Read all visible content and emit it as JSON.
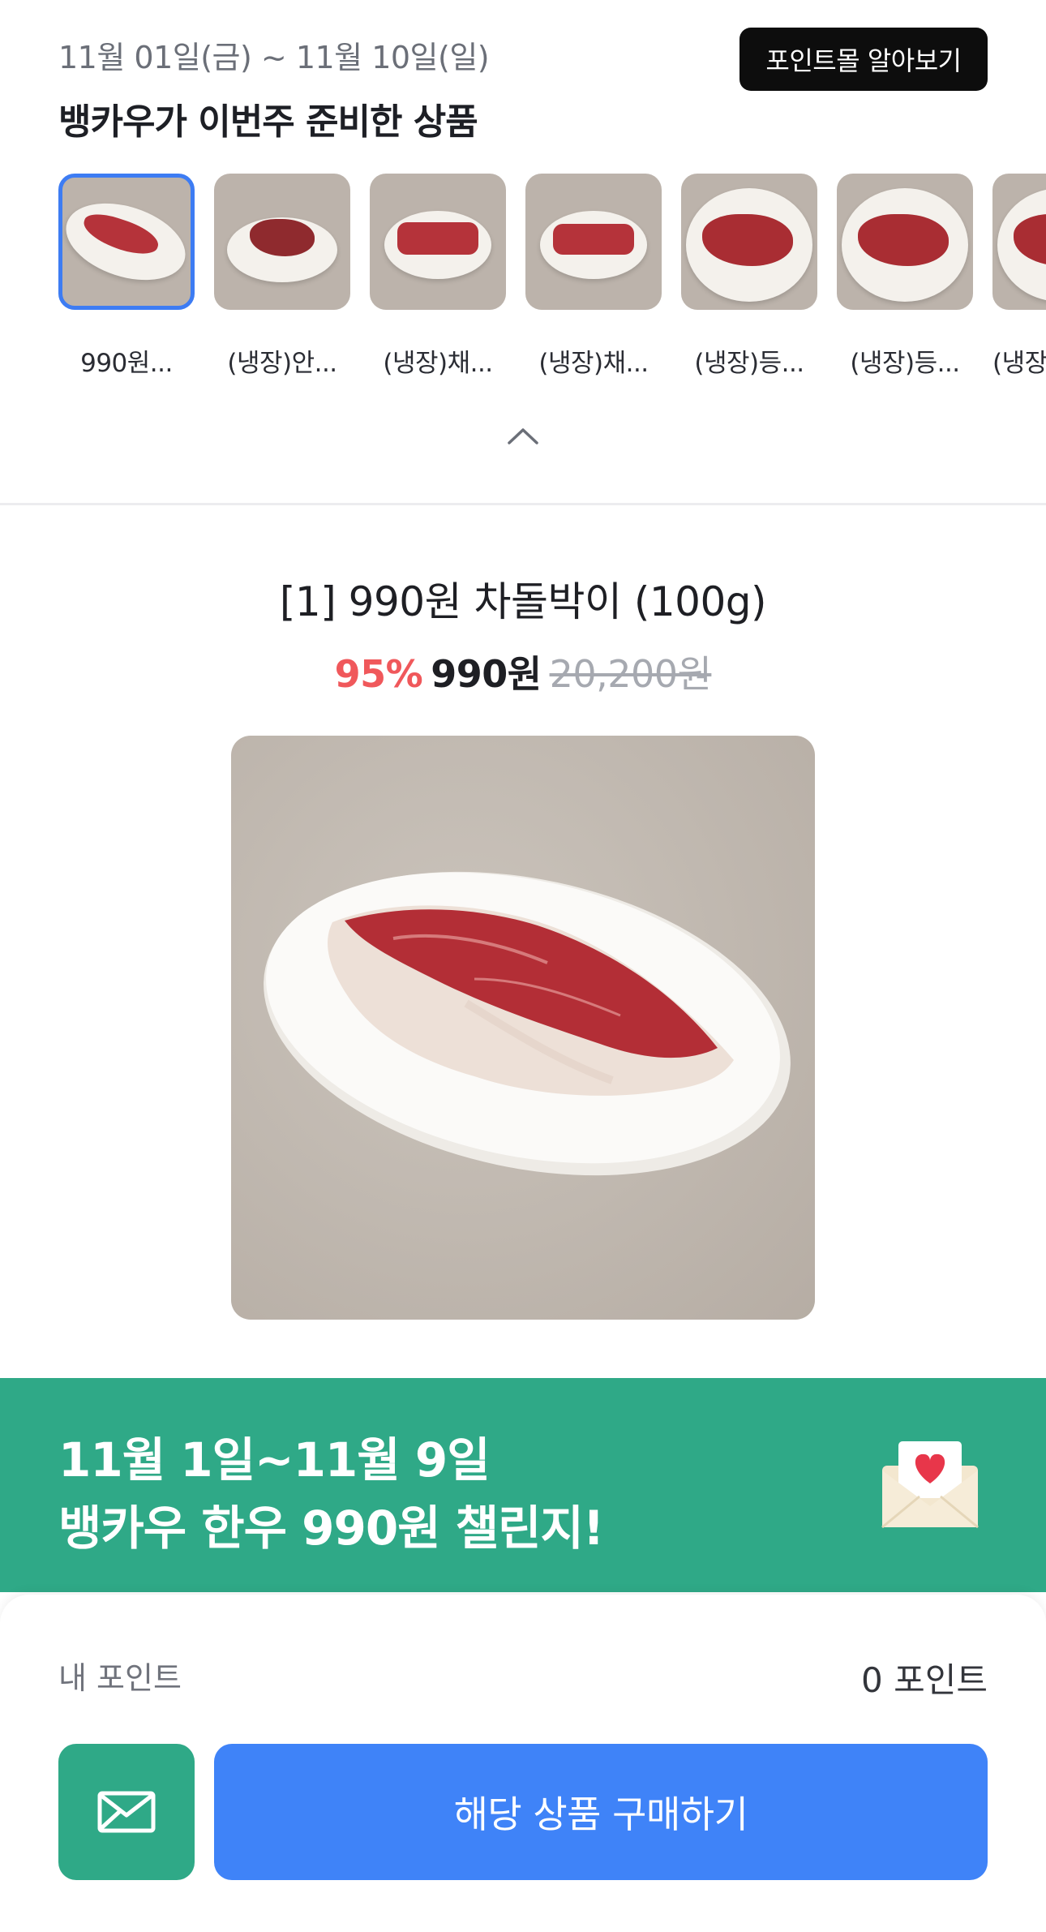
{
  "header": {
    "date_range": "11월 01일(금) ~ 11월 10일(일)",
    "headline": "뱅카우가 이번주 준비한 상품",
    "pointmall_button": "포인트몰 알아보기"
  },
  "thumbnails": [
    {
      "label": "990원...",
      "selected": true
    },
    {
      "label": "(냉장)안...",
      "selected": false
    },
    {
      "label": "(냉장)채...",
      "selected": false
    },
    {
      "label": "(냉장)채...",
      "selected": false
    },
    {
      "label": "(냉장)등...",
      "selected": false
    },
    {
      "label": "(냉장)등...",
      "selected": false
    },
    {
      "label": "(냉장",
      "selected": false
    }
  ],
  "product": {
    "title": "[1] 990원  차돌박이 (100g)",
    "discount": "95%",
    "price": "990원",
    "original_price": "20,200원"
  },
  "banner": {
    "line1": "11월 1일~11월 9일",
    "line2": "뱅카우 한우 990원 챌린지!",
    "icon": "envelope-heart-icon"
  },
  "bottom": {
    "points_label": "내 포인트",
    "points_value": "0 포인트",
    "buy_button": "해당 상품 구매하기",
    "mail_icon": "mail-icon"
  },
  "colors": {
    "accent_blue": "#3f83f8",
    "accent_green": "#2fa987",
    "discount_red": "#f0585b"
  }
}
